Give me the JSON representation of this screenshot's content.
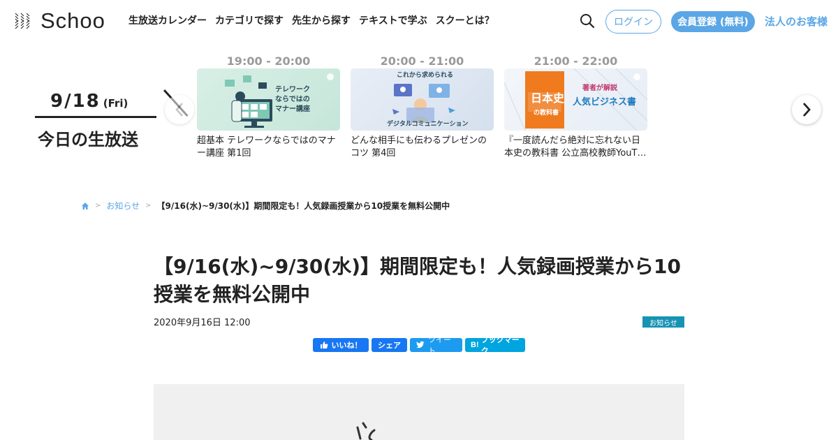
{
  "header": {
    "logo_text": "Schoo",
    "nav": [
      "生放送カレンダー",
      "カテゴリで探す",
      "先生から探す",
      "テキストで学ぶ",
      "スクーとは？"
    ],
    "login_label": "ログイン",
    "signup_label": "会員登録 (無料)",
    "corporate_label": "法人のお客様"
  },
  "live": {
    "date": "9/18",
    "day_of_week": "(Fri)",
    "today_label": "今日の生放送",
    "cards": [
      {
        "time": "19:00 - 20:00",
        "title": "超基本 テレワークならではのマナー講座 第1回",
        "thumb_text": [
          "テレワーク",
          "ならではの",
          "マナー講座"
        ]
      },
      {
        "time": "20:00 - 21:00",
        "title": "どんな相手にも伝わるプレゼンのコツ 第4回",
        "thumb_text": [
          "これから求められる",
          "デジタルコミュニケーション"
        ]
      },
      {
        "time": "21:00 - 22:00",
        "title": "『一度読んだら絶対に忘れない日本史の教科書 公立高校教師YouT…",
        "thumb_text": [
          "日本史",
          "の教科書",
          "著者が解説",
          "人気ビジネス書"
        ]
      }
    ]
  },
  "breadcrumb": {
    "section": "お知らせ",
    "current": "【9/16(水)~9/30(水)】期間限定も！人気録画授業から10授業を無料公開中"
  },
  "article": {
    "title": "【9/16(水)~9/30(水)】期間限定も！人気録画授業から10授業を無料公開中",
    "date": "2020年9月16日 12:00",
    "category": "お知らせ"
  },
  "share": {
    "like": "いいね！",
    "share": "シェア",
    "tweet": "ツイート",
    "hatena": "ブックマーク"
  },
  "colors": {
    "accent": "#5aa6e6",
    "badge": "#1793b4",
    "facebook": "#1877f2",
    "twitter": "#1d9bf0",
    "hatena": "#00a4de"
  }
}
